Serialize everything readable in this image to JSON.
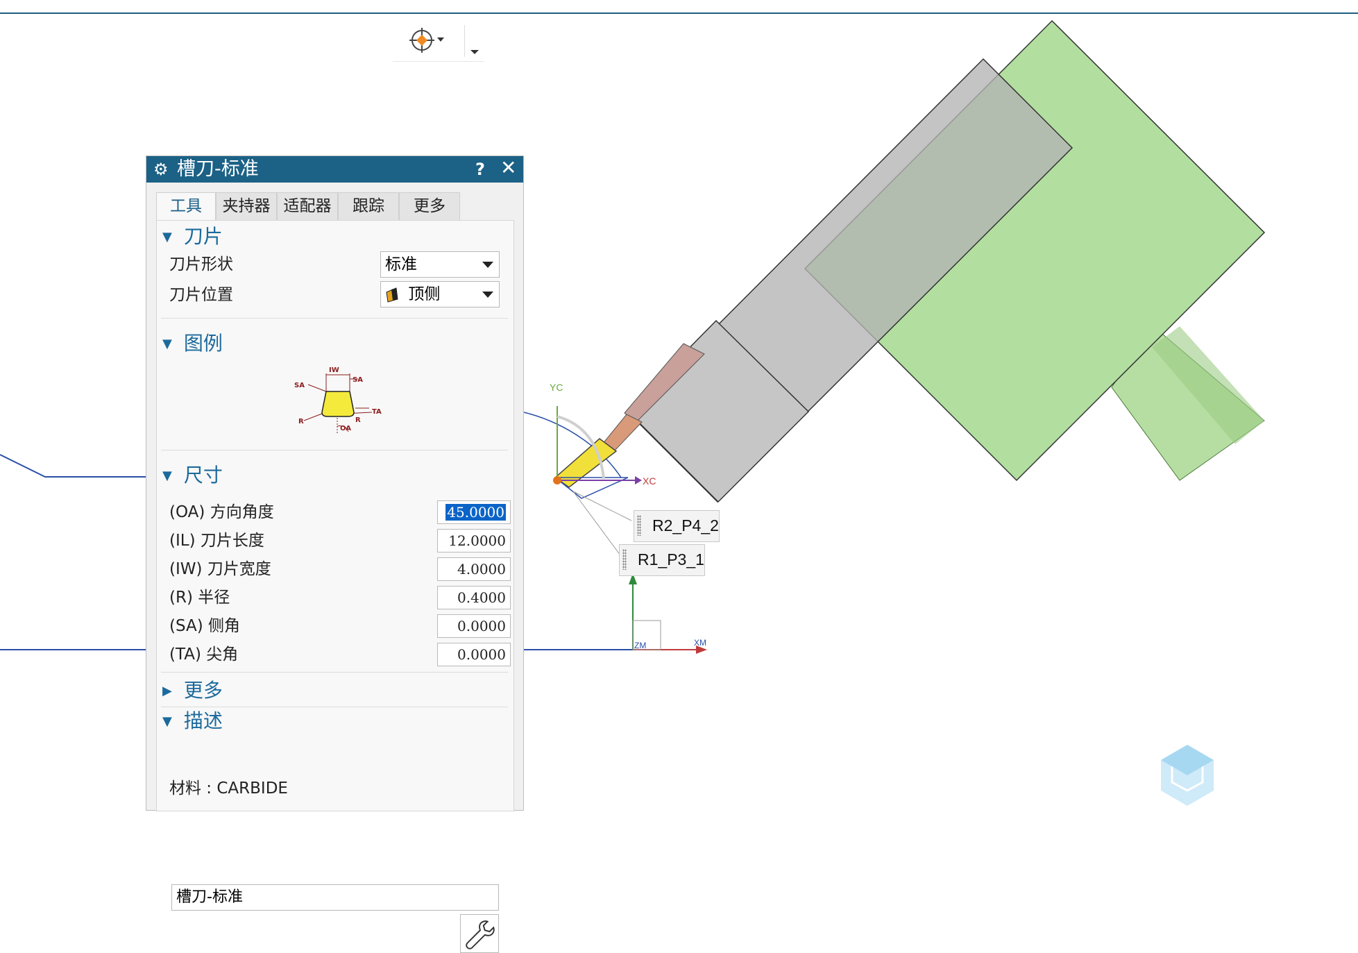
{
  "snap_toolbar": {
    "snap_icon": "snap-point-icon",
    "dropdown_icon": "chevron-down-icon"
  },
  "dialog": {
    "title": "槽刀-标准",
    "help": "?",
    "close": "✕",
    "tabs": [
      "工具",
      "夹持器",
      "适配器",
      "跟踪",
      "更多"
    ],
    "active_tab": "工具",
    "sections": {
      "blade": {
        "title": "刀片",
        "shape_label": "刀片形状",
        "shape_value": "标准",
        "position_label": "刀片位置",
        "position_value": "顶侧"
      },
      "legend": {
        "title": "图例",
        "diagram_labels": [
          "IW",
          "SA",
          "SA",
          "TA",
          "R",
          "R",
          "OA"
        ]
      },
      "dimensions": {
        "title": "尺寸",
        "fields": [
          {
            "label": "(OA) 方向角度",
            "value": "45.0000"
          },
          {
            "label": "(IL) 刀片长度",
            "value": "12.0000"
          },
          {
            "label": "(IW) 刀片宽度",
            "value": "4.0000"
          },
          {
            "label": "(R) 半径",
            "value": "0.4000"
          },
          {
            "label": "(SA) 侧角",
            "value": "0.0000"
          },
          {
            "label": "(TA) 尖角",
            "value": "0.0000"
          }
        ]
      },
      "more": {
        "title": "更多"
      },
      "description": {
        "title": "描述",
        "value": "槽刀-标准",
        "material_label": "材料 : CARBIDE"
      }
    }
  },
  "viewport": {
    "axis_labels": {
      "yc": "YC",
      "xc": "XC",
      "zm": "ZM",
      "xm": "XM"
    },
    "tags": [
      "R2_P4_2",
      "R1_P3_1"
    ],
    "colors": {
      "tool_body": "#c6c6c6",
      "holder": "#b2dfa0",
      "insert": "#f2e03a",
      "accent": "#1c6186"
    }
  }
}
